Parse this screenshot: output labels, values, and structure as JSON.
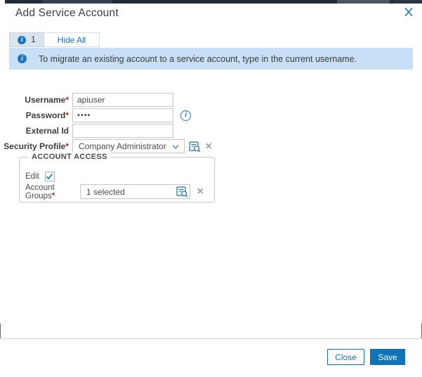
{
  "window": {
    "title": "Add Service Account"
  },
  "tab_bar": {
    "info_count": "1",
    "hide_all_label": "Hide All"
  },
  "banner": {
    "message": "To migrate an existing account to a service account, type in the current username."
  },
  "form": {
    "username_label": "Username",
    "username_required": "*",
    "username_value": "apiuser",
    "password_label": "Password",
    "password_required": "*",
    "password_value": "••••",
    "external_id_label": "External Id",
    "external_id_value": "",
    "security_profile_label": "Security Profile",
    "security_profile_required": "*",
    "security_profile_value": "Company Administrator"
  },
  "account_access": {
    "legend": "ACCOUNT ACCESS",
    "edit_label": "Edit",
    "edit_checked": true,
    "account_groups_label": "Account Groups",
    "account_groups_required": "*",
    "account_groups_value": "1 selected"
  },
  "footer": {
    "close_label": "Close",
    "save_label": "Save"
  },
  "icons": {
    "info_glyph": "i",
    "clear_glyph": "✕"
  },
  "colors": {
    "accent_blue": "#1a6eb5",
    "save_button_bg": "#1173b8",
    "banner_bg": "#c7e0f5",
    "tab_active_bg": "#dae4ee",
    "required_red": "#9b2d30",
    "page_strip_bg": "#232b38"
  }
}
